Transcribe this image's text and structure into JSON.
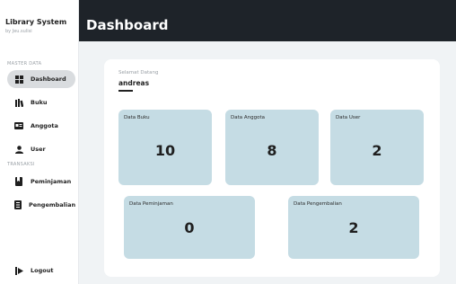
{
  "app": {
    "title": "Library System",
    "subtitle": "by Jeu.sulisi"
  },
  "sidebar": {
    "sections": [
      {
        "label": "MASTER DATA"
      },
      {
        "label": "TRANSAKSI"
      }
    ],
    "items": [
      {
        "label": "Dashboard",
        "icon": "dashboard-grid-icon",
        "active": true
      },
      {
        "label": "Buku",
        "icon": "books-icon",
        "active": false
      },
      {
        "label": "Anggota",
        "icon": "id-card-icon",
        "active": false
      },
      {
        "label": "User",
        "icon": "user-icon",
        "active": false
      },
      {
        "label": "Peminjaman",
        "icon": "bookmark-book-icon",
        "active": false
      },
      {
        "label": "Pengembalian",
        "icon": "return-book-icon",
        "active": false
      }
    ],
    "logout": {
      "label": "Logout",
      "icon": "logout-icon"
    }
  },
  "header": {
    "title": "Dashboard"
  },
  "welcome": {
    "label": "Selamat Datang",
    "user": "andreas"
  },
  "cards": [
    {
      "label": "Data Buku",
      "value": "10"
    },
    {
      "label": "Data Anggota",
      "value": "8"
    },
    {
      "label": "Data User",
      "value": "2"
    },
    {
      "label": "Data Peminjaman",
      "value": "0"
    },
    {
      "label": "Data Pengembalian",
      "value": "2"
    }
  ],
  "colors": {
    "topbar": "#1e2329",
    "card": "#c5dce4",
    "active_nav": "#d9dcdf"
  }
}
